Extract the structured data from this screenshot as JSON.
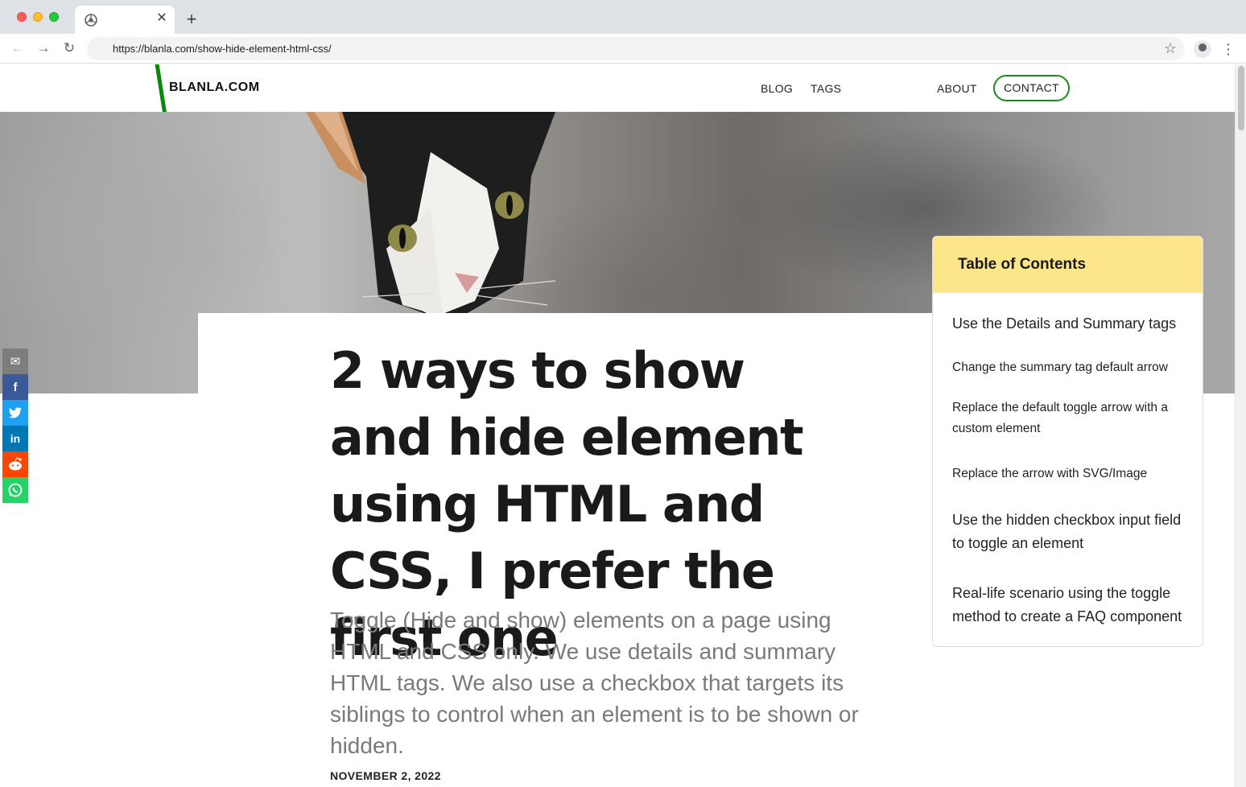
{
  "browser": {
    "url": "https://blanla.com/show-hide-element-html-css/",
    "tab": {
      "close_glyph": "✕",
      "favicon": "chrome-icon"
    },
    "new_tab_glyph": "+",
    "icons": {
      "back": "back-arrow-icon",
      "forward": "forward-arrow-icon",
      "reload": "reload-icon",
      "bookmark": "star-icon",
      "profile": "profile-icon",
      "menu": "kebab-menu-icon"
    }
  },
  "site": {
    "logo": "BLANLA.COM",
    "nav": [
      {
        "label": "BLOG"
      },
      {
        "label": "TAGS"
      },
      {
        "label": "ABOUT"
      },
      {
        "label": "CONTACT"
      }
    ],
    "accent_color": "#1c8a1c"
  },
  "article": {
    "title": "2 ways to show and hide element using HTML and CSS, I prefer the first one",
    "lede": "Toggle (Hide and show) elements on a page using HTML and CSS only. We use details and summary HTML tags. We also use a checkbox that targets its siblings to control when an element is to be shown or hidden.",
    "date": "NOVEMBER 2, 2022"
  },
  "share": [
    {
      "name": "email",
      "glyph": "✉",
      "color": "#7d7d7d"
    },
    {
      "name": "facebook",
      "glyph": "f",
      "color": "#3b5998"
    },
    {
      "name": "twitter",
      "glyph": "🐦",
      "color": "#1da1f2"
    },
    {
      "name": "linkedin",
      "glyph": "in",
      "color": "#0077b5"
    },
    {
      "name": "reddit",
      "glyph": "👽",
      "color": "#ff4500"
    },
    {
      "name": "whatsapp",
      "glyph": "✆",
      "color": "#25d366"
    }
  ],
  "toc": {
    "title": "Table of Contents",
    "header_color": "#fde68a",
    "items": [
      {
        "label": "Use the Details and Summary tags"
      },
      {
        "label": "Change the summary tag default arrow"
      },
      {
        "label": "Replace the default toggle arrow with a custom element"
      },
      {
        "label": "Replace the arrow with SVG/Image"
      },
      {
        "label": "Use the hidden checkbox input field to toggle an element"
      },
      {
        "label": "Real-life scenario using the toggle method to create a FAQ component"
      }
    ]
  }
}
